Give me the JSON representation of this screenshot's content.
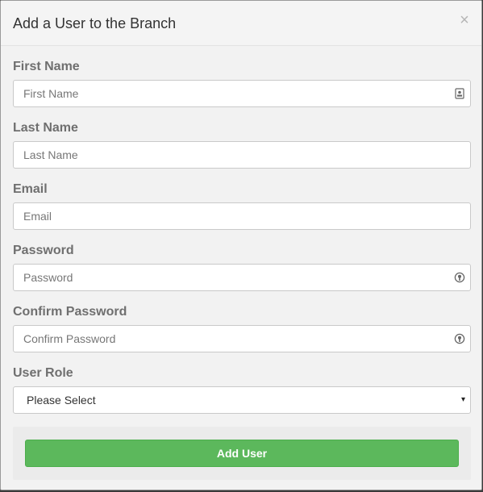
{
  "modal": {
    "title": "Add a User to the Branch",
    "close_label": "×"
  },
  "form": {
    "first_name": {
      "label": "First Name",
      "placeholder": "First Name",
      "value": "",
      "icon": "contact-card-icon"
    },
    "last_name": {
      "label": "Last Name",
      "placeholder": "Last Name",
      "value": ""
    },
    "email": {
      "label": "Email",
      "placeholder": "Email",
      "value": ""
    },
    "password": {
      "label": "Password",
      "placeholder": "Password",
      "value": "",
      "icon": "password-key-icon"
    },
    "confirm_password": {
      "label": "Confirm Password",
      "placeholder": "Confirm Password",
      "value": "",
      "icon": "password-key-icon"
    },
    "user_role": {
      "label": "User Role",
      "selected": "Please Select",
      "caret": "▾"
    }
  },
  "footer": {
    "submit_label": "Add User"
  },
  "colors": {
    "primary_button": "#5cb85c",
    "label_text": "#6f6f6f",
    "modal_background": "#f2f2f2"
  }
}
